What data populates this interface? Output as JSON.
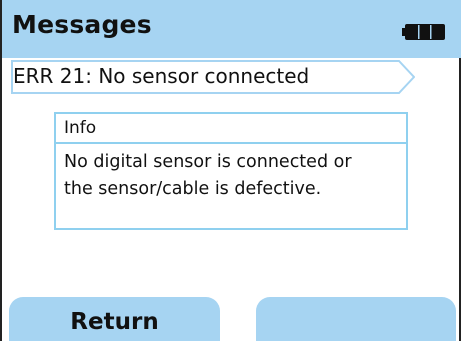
{
  "header": {
    "title": "Messages",
    "battery_icon": "battery-full-icon"
  },
  "error": {
    "text": "ERR 21: No sensor connected"
  },
  "info": {
    "title": "Info",
    "line1": "No digital sensor is connected or",
    "line2": "the sensor/cable is defective."
  },
  "softkeys": {
    "left_label": "Return",
    "right_label": ""
  },
  "colors": {
    "accent": "#a6d4f2",
    "border": "#8fd0ef",
    "text": "#111111"
  }
}
